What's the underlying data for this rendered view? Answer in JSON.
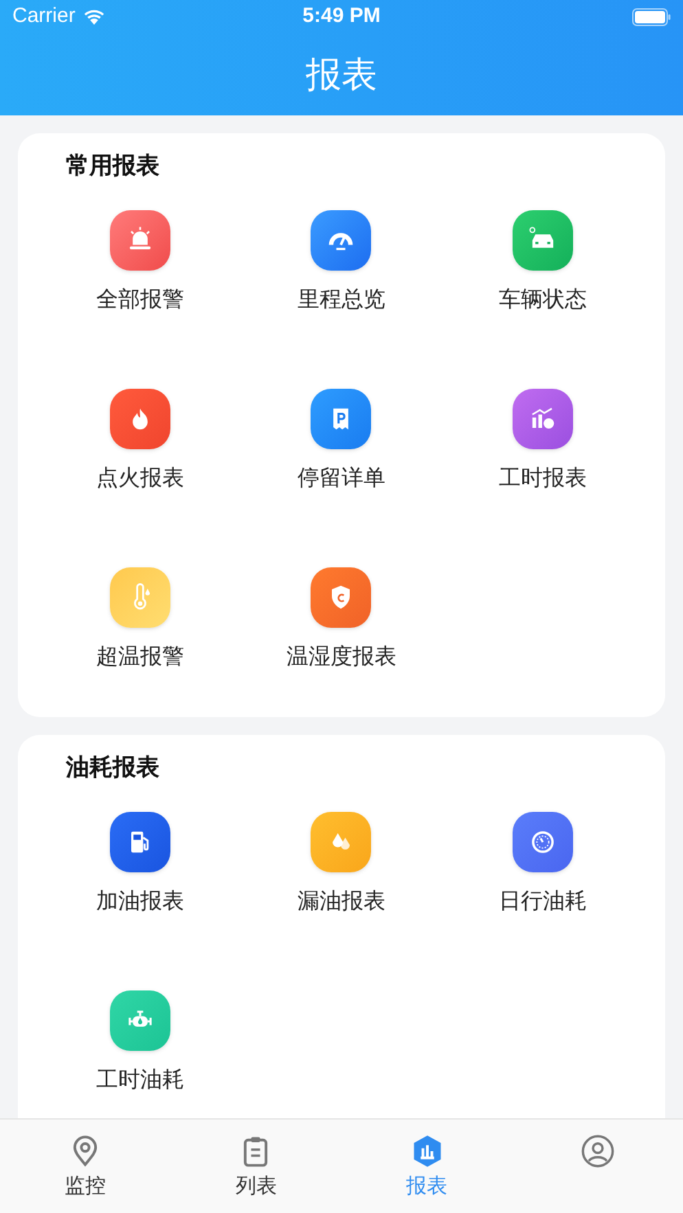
{
  "status_bar": {
    "carrier": "Carrier",
    "time": "5:49 PM"
  },
  "header": {
    "title": "报表"
  },
  "sections": [
    {
      "title": "常用报表",
      "items": [
        {
          "label": "全部报警",
          "kind": "alarm"
        },
        {
          "label": "里程总览",
          "kind": "gauge"
        },
        {
          "label": "车辆状态",
          "kind": "car"
        },
        {
          "label": "点火报表",
          "kind": "flame"
        },
        {
          "label": "停留详单",
          "kind": "parking"
        },
        {
          "label": "工时报表",
          "kind": "chart"
        },
        {
          "label": "超温报警",
          "kind": "thermometer"
        },
        {
          "label": "温湿度报表",
          "kind": "shield"
        }
      ]
    },
    {
      "title": "油耗报表",
      "items": [
        {
          "label": "加油报表",
          "kind": "fuel"
        },
        {
          "label": "漏油报表",
          "kind": "drops"
        },
        {
          "label": "日行油耗",
          "kind": "dial"
        },
        {
          "label": "工时油耗",
          "kind": "engine"
        }
      ]
    }
  ],
  "tab_bar": [
    {
      "label": "监控",
      "kind": "pin",
      "selected": false
    },
    {
      "label": "列表",
      "kind": "clipboard",
      "selected": false
    },
    {
      "label": "报表",
      "kind": "bars",
      "selected": true
    },
    {
      "kind": "person",
      "selected": false
    }
  ]
}
